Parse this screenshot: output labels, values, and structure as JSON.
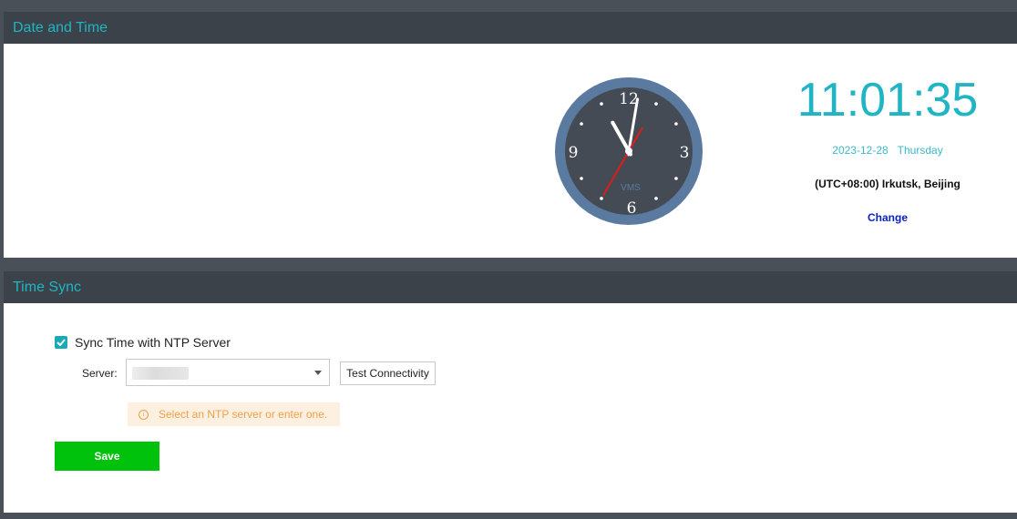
{
  "date_time": {
    "title": "Date and Time",
    "clock_brand": "VMS",
    "clock_numerals": [
      "12",
      "3",
      "6",
      "9"
    ],
    "clock_time": {
      "hours": 11,
      "minutes": 1,
      "seconds": 35
    },
    "digital_time": "11:01:35",
    "date": "2023-12-28",
    "weekday": "Thursday",
    "timezone": "(UTC+08:00) Irkutsk, Beijing",
    "change_label": "Change"
  },
  "time_sync": {
    "title": "Time Sync",
    "sync_label": "Sync Time with NTP Server",
    "sync_checked": true,
    "server_label": "Server:",
    "test_label": "Test Connectivity",
    "hint": "Select an NTP server or enter one.",
    "save_label": "Save"
  },
  "colors": {
    "accent": "#1fb5c4",
    "save": "#00c10b",
    "hint_text": "#f0a04b",
    "clock_rim": "#5b7aa0",
    "clock_face": "#454b55"
  },
  "icons": [
    "check-icon",
    "caret-down-icon",
    "info-icon"
  ]
}
